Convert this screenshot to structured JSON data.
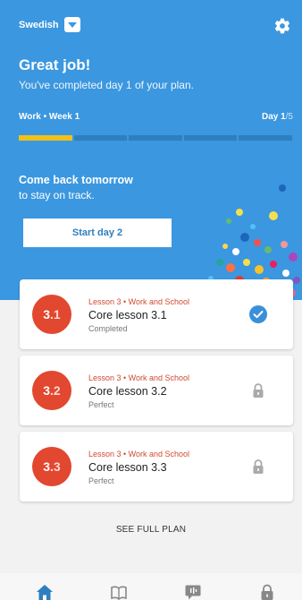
{
  "header": {
    "language": "Swedish",
    "language_icon": "chevron-down-icon",
    "settings_icon": "gear-icon"
  },
  "hero": {
    "title": "Great job!",
    "subtitle": "You've completed day 1 of your plan.",
    "week_label": "Work • Week 1",
    "day_prefix": "Day ",
    "day_current": "1",
    "day_total": "/5",
    "progress": {
      "completed": 1,
      "segments": 5
    },
    "progress_color": "#f2c117",
    "comeback_title": "Come back tomorrow",
    "comeback_sub": "to stay on track.",
    "start_button": "Start day 2",
    "background_color": "#3b97df"
  },
  "lessons": [
    {
      "badge_main": "3",
      "badge_sub": ".1",
      "kicker": "Lesson 3 • Work and School",
      "title": "Core lesson 3.1",
      "status": "Completed",
      "status_icon": "check-circle-icon"
    },
    {
      "badge_main": "3",
      "badge_sub": ".2",
      "kicker": "Lesson 3 • Work and School",
      "title": "Core lesson 3.2",
      "status": "Perfect",
      "status_icon": "lock-icon"
    },
    {
      "badge_main": "3",
      "badge_sub": ".3",
      "kicker": "Lesson 3 • Work and School",
      "title": "Core lesson 3.3",
      "status": "Perfect",
      "status_icon": "lock-icon"
    }
  ],
  "badge_color": "#e2472f",
  "see_full_plan": "SEE FULL PLAN",
  "tabbar": {
    "active_color": "#2d7fbf",
    "items": [
      {
        "icon": "home-icon",
        "active": true
      },
      {
        "icon": "book-icon",
        "active": false
      },
      {
        "icon": "chat-icon",
        "active": false
      },
      {
        "icon": "lock-icon",
        "active": false
      }
    ]
  }
}
